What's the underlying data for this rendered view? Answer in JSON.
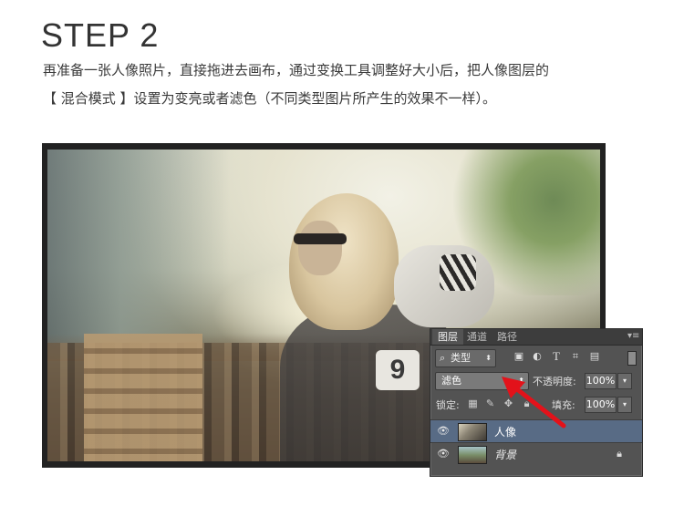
{
  "header": {
    "step_title": "STEP 2",
    "line1": "再准备一张人像照片，直接拖进去画布，通过变换工具调整好大小后，把人像图层的",
    "line2": "【 混合模式 】设置为变亮或者滤色（不同类型图片所产生的效果不一样）。"
  },
  "photo": {
    "jacket_number": "9"
  },
  "layers_panel": {
    "tabs": [
      "图层",
      "通道",
      "路径"
    ],
    "active_tab": "图层",
    "filter": {
      "label": "类型",
      "search_icon": "search-icon"
    },
    "filter_icons": [
      "image-icon",
      "adjustment-icon",
      "text-icon",
      "shape-icon",
      "smart-object-icon"
    ],
    "blend_mode": "滤色",
    "opacity_label": "不透明度:",
    "opacity_value": "100%",
    "lock_label": "锁定:",
    "fill_label": "填充:",
    "fill_value": "100%",
    "layers": [
      {
        "name": "人像",
        "selected": true,
        "visible": true
      },
      {
        "name": "背景",
        "selected": false,
        "visible": true,
        "locked": true
      }
    ]
  },
  "colors": {
    "panel_bg": "#535353",
    "selection": "#586b85",
    "arrow": "#e3121a"
  }
}
